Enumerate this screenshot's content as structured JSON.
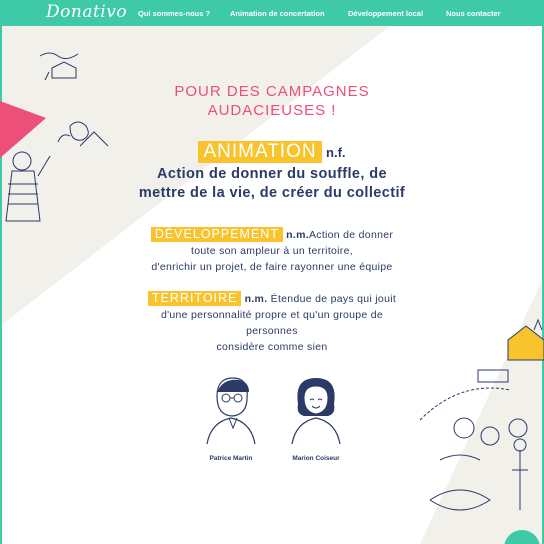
{
  "nav": {
    "logo": "Donativo",
    "links": [
      {
        "label": "Qui sommes-nous ?"
      },
      {
        "label": "Animation de concertation"
      },
      {
        "label": "Développement local"
      },
      {
        "label": "Nous contacter"
      }
    ]
  },
  "hero": {
    "headline_line1": "POUR DES CAMPAGNES",
    "headline_line2": "AUDACIEUSES !"
  },
  "definitions": {
    "animation": {
      "term": "ANIMATION",
      "pos": "n.f.",
      "line1": "Action de donner du souffle, de",
      "line2": "mettre de la vie, de créer du collectif"
    },
    "developpement": {
      "term": "DÉVELOPPEMENT",
      "pos": "n.m.",
      "line1": "Action de donner",
      "line2": "toute son ampleur à un territoire,",
      "line3": "d'enrichir un projet, de faire rayonner une équipe"
    },
    "territoire": {
      "term": "TERRITOIRE",
      "pos": "n.m.",
      "line1": "Étendue de pays qui jouit",
      "line2": "d'une personnalité propre et qu'un groupe de",
      "line3": "personnes",
      "line4": "considère comme sien"
    }
  },
  "team": [
    {
      "name": "Patrice Martin"
    },
    {
      "name": "Marion Coiseur"
    }
  ],
  "colors": {
    "accent_green": "#3ec9a7",
    "headline_pink": "#ec4f79",
    "tag_yellow": "#f9c32d",
    "text_navy": "#2b3a67"
  },
  "icons": [
    "village-illustration-left",
    "village-illustration-right",
    "scroll-top-button"
  ]
}
